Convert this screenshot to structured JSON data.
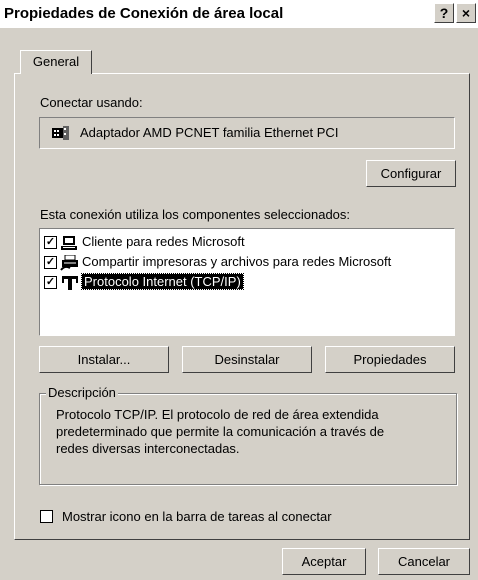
{
  "window": {
    "title": "Propiedades de Conexión de área local",
    "help_button": "?",
    "close_button": "×"
  },
  "tabs": [
    {
      "label": "General"
    }
  ],
  "connect": {
    "label": "Conectar usando:",
    "adapter": "Adaptador AMD PCNET familia Ethernet PCI",
    "configure_button": "Configurar"
  },
  "components": {
    "label": "Esta conexión utiliza los componentes seleccionados:",
    "items": [
      {
        "label": "Cliente para redes Microsoft",
        "checked": true,
        "icon": "client-icon"
      },
      {
        "label": "Compartir impresoras y archivos para redes Microsoft",
        "checked": true,
        "icon": "printer-share-icon"
      },
      {
        "label": "Protocolo Internet (TCP/IP)",
        "checked": true,
        "icon": "protocol-icon",
        "selected": true
      }
    ],
    "install_button": "Instalar...",
    "uninstall_button": "Desinstalar",
    "properties_button": "Propiedades"
  },
  "description": {
    "legend": "Descripción",
    "lines": [
      "Protocolo TCP/IP. El protocolo de red de área extendida",
      "predeterminado que permite la comunicación a través de",
      "redes diversas interconectadas."
    ]
  },
  "show_icon": {
    "label": "Mostrar icono en la barra de tareas al conectar",
    "checked": false
  },
  "footer": {
    "ok_button": "Aceptar",
    "cancel_button": "Cancelar"
  }
}
